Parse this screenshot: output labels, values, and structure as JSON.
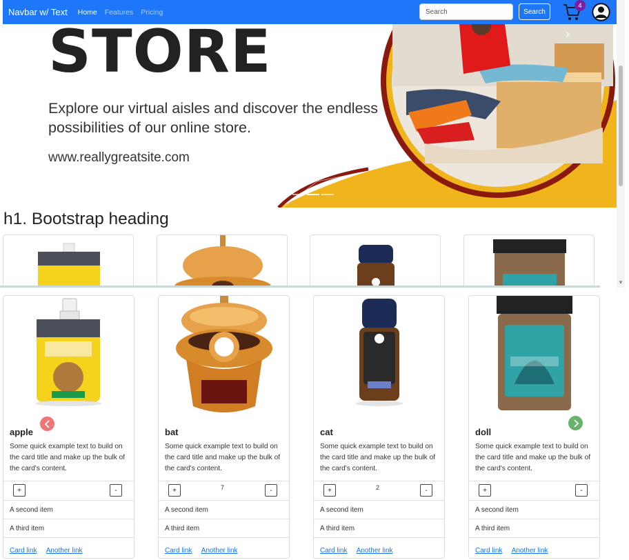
{
  "navbar": {
    "brand": "Navbar w/ Text",
    "links": [
      {
        "label": "Home",
        "active": true
      },
      {
        "label": "Features",
        "active": false
      },
      {
        "label": "Pricing",
        "active": false
      }
    ],
    "search": {
      "placeholder": "Search",
      "button_label": "Search"
    },
    "cart_count": "4",
    "icons": [
      "cart-icon",
      "user-icon"
    ],
    "color": "#1e77f8"
  },
  "hero": {
    "title": "STORE",
    "subtitle": "Explore our virtual aisles and discover the endless possibilities of our online store.",
    "url": "www.reallygreatsite.com",
    "accent_colors": [
      "#f0b41c",
      "#8a1a0e"
    ]
  },
  "heading": "h1. Bootstrap heading",
  "cards": [
    {
      "title": "apple",
      "text": "Some quick example text to build on the card title and make up the bulk of the card's content.",
      "quantity": "",
      "item2": "A second item",
      "item3": "A third item",
      "link1": "Card link",
      "link2": "Another link"
    },
    {
      "title": "bat",
      "text": "Some quick example text to build on the card title and make up the bulk of the card's content.",
      "quantity": "7",
      "item2": "A second item",
      "item3": "A third item",
      "link1": "Card link",
      "link2": "Another link"
    },
    {
      "title": "cat",
      "text": "Some quick example text to build on the card title and make up the bulk of the card's content.",
      "quantity": "2",
      "item2": "A second item",
      "item3": "A third item",
      "link1": "Card link",
      "link2": "Another link"
    },
    {
      "title": "doll",
      "text": "Some quick example text to build on the card title and make up the bulk of the card's content.",
      "quantity": "",
      "item2": "A second item",
      "item3": "A third item",
      "link1": "Card link",
      "link2": "Another link"
    }
  ],
  "qty_buttons": {
    "plus": "+",
    "minus": "-"
  },
  "slider_arrows": {
    "left_color": "#ef7676",
    "right_color": "#67b36b"
  }
}
